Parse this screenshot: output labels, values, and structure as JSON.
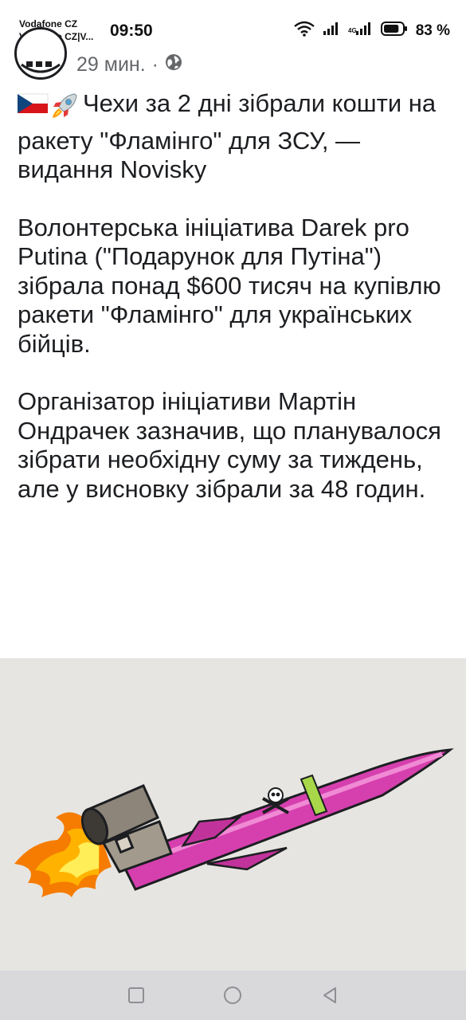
{
  "status_bar": {
    "carrier_1": "Vodafone CZ",
    "carrier_2": "Vodafone CZ|V...",
    "time": "09:50",
    "network_label": "4G",
    "battery_percent": "83 %",
    "battery_level": 0.83
  },
  "post": {
    "time_ago": "29 мин.",
    "separator": "·",
    "audience_icon": "globe-icon",
    "headline_emojis": [
      "czech-flag-emoji",
      "rocket-emoji"
    ],
    "headline": "Чехи за 2 дні зібрали кошти на ракету \"Фламінго\" для ЗСУ, — видання Novisky",
    "paragraph_1": "Волонтерська ініціатива Darek pro Putina (\"Подарунок для Путіна\") зібрала понад $600 тисяч на купівлю ракети \"Фламінго\" для українських бійців.",
    "paragraph_2": "Організатор ініціативи Мартін Ондрачек зазначив, що планувалося зібрати необхідну суму за тиждень, але у висновку зібрали за 48 годин."
  },
  "nav_bar": {
    "buttons": [
      "recents-button",
      "home-button",
      "back-button"
    ]
  },
  "colors": {
    "text": "#1c1e21",
    "secondary_text": "#65676b",
    "image_background": "#e7e5e1",
    "missile_body": "#d63fae",
    "missile_band": "#a8d84a",
    "nav_bar": "#d9d9dc"
  }
}
